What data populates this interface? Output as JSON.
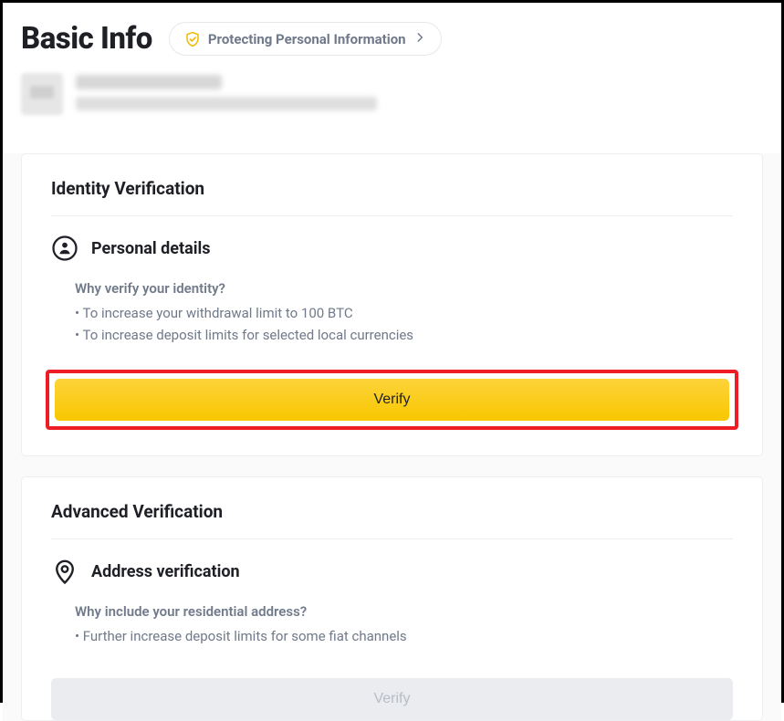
{
  "header": {
    "title": "Basic Info",
    "protect_label": "Protecting Personal Information"
  },
  "identity": {
    "card_title": "Identity Verification",
    "section_label": "Personal details",
    "question": "Why verify your identity?",
    "bullets": [
      "• To increase your withdrawal limit to 100 BTC",
      "• To increase deposit limits for selected local currencies"
    ],
    "verify_label": "Verify"
  },
  "advanced": {
    "card_title": "Advanced Verification",
    "section_label": "Address verification",
    "question": "Why include your residential address?",
    "bullets": [
      "• Further increase deposit limits for some fiat channels"
    ],
    "verify_label": "Verify"
  }
}
